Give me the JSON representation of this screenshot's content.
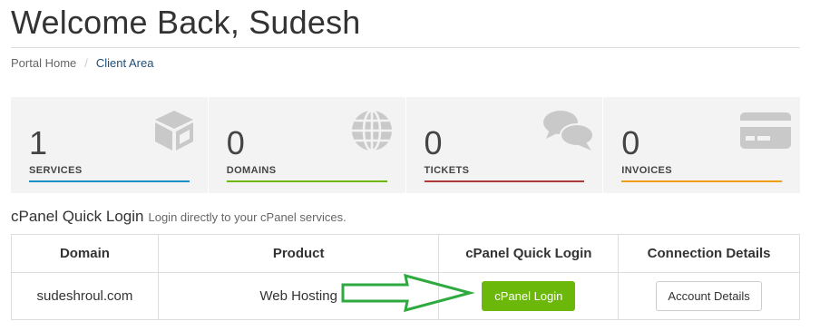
{
  "header": {
    "title": "Welcome Back, Sudesh"
  },
  "breadcrumb": {
    "items": [
      "Portal Home",
      "Client Area"
    ],
    "separator": "/"
  },
  "tiles": [
    {
      "count": "1",
      "label": "SERVICES",
      "accent": "#1a8fc6",
      "icon": "cube-icon"
    },
    {
      "count": "0",
      "label": "DOMAINS",
      "accent": "#6cb80a",
      "icon": "globe-icon"
    },
    {
      "count": "0",
      "label": "TICKETS",
      "accent": "#b03a3a",
      "icon": "chat-bubbles-icon"
    },
    {
      "count": "0",
      "label": "INVOICES",
      "accent": "#f39c12",
      "icon": "credit-card-icon"
    }
  ],
  "cpanel": {
    "heading": "cPanel Quick Login",
    "subheading": "Login directly to your cPanel services.",
    "columns": [
      "Domain",
      "Product",
      "cPanel Quick Login",
      "Connection Details"
    ],
    "rows": [
      {
        "domain": "sudeshroul.com",
        "product": "Web Hosting",
        "login_button": "cPanel Login",
        "details_button": "Account Details"
      }
    ]
  },
  "colors": {
    "login_button": "#6cb80a",
    "annotation_arrow": "#2eaa3f",
    "tile_background": "#f3f3f3",
    "icon_gray": "#c9c9c9"
  }
}
